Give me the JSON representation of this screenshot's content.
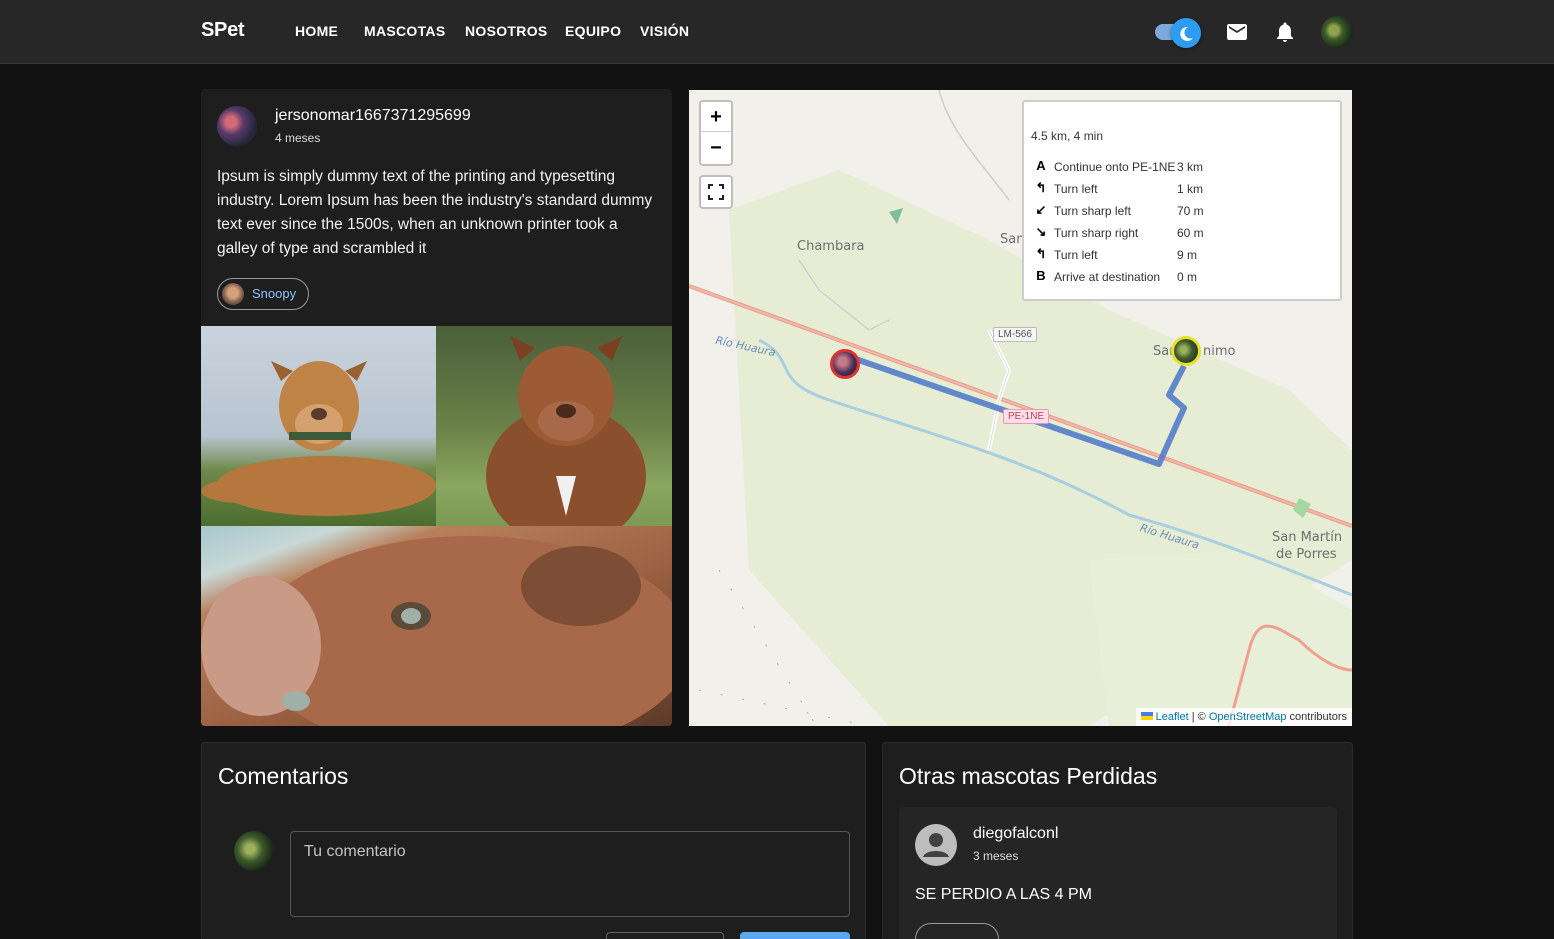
{
  "nav": {
    "brand": "SPet",
    "links": [
      "HOME",
      "MASCOTAS",
      "NOSOTROS",
      "EQUIPO",
      "VISIÓN"
    ],
    "icons": [
      "theme-toggle",
      "mail-icon",
      "bell-icon",
      "avatar"
    ]
  },
  "post": {
    "user": "jersonomar1667371295699",
    "time": "4 meses",
    "text": "Ipsum is simply dummy text of the printing and typesetting industry. Lorem Ipsum has been the industry's standard dummy text ever since the 1500s, when an unknown printer took a galley of type and scrambled it",
    "pet_chip": "Snoopy"
  },
  "map": {
    "zoom_in": "+",
    "zoom_out": "−",
    "route": {
      "summary": "4.5 km, 4 min",
      "steps": [
        {
          "icon": "A",
          "text": "Continue onto PE-1NE",
          "distance": "3 km"
        },
        {
          "icon": "↰",
          "text": "Turn left",
          "distance": "1 km"
        },
        {
          "icon": "↙",
          "text": "Turn sharp left",
          "distance": "70 m"
        },
        {
          "icon": "↘",
          "text": "Turn sharp right",
          "distance": "60 m"
        },
        {
          "icon": "↰",
          "text": "Turn left",
          "distance": "9 m"
        },
        {
          "icon": "B",
          "text": "Arrive at destination",
          "distance": "0 m"
        }
      ]
    },
    "labels": {
      "chambara": "Chambara",
      "san_top": "San",
      "rio_huaura_1": "Río Huaura",
      "rio_huaura_2": "Río Huaura",
      "lm566": "LM-566",
      "pe1ne": "PE-1NE",
      "san_jeronimo_a": "Sar",
      "san_jeronimo_b": "nimo",
      "san_martin_1": "San Martín",
      "san_martin_2": "de Porres"
    },
    "attribution": {
      "leaflet": "Leaflet",
      "sep": " | © ",
      "osm": "OpenStreetMap",
      "contrib": " contributors"
    }
  },
  "comments": {
    "title": "Comentarios",
    "placeholder": "Tu comentario"
  },
  "others": {
    "title": "Otras mascotas Perdidas",
    "items": [
      {
        "user": "diegofalconl",
        "time": "3 meses",
        "text": "SE PERDIO A LAS 4 PM"
      }
    ]
  },
  "colors": {
    "accent": "#2f9cf3",
    "route": "#4a74c9",
    "link": "#8cc2ff"
  }
}
